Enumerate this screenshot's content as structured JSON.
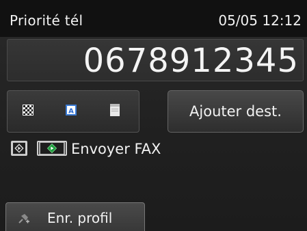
{
  "header": {
    "title": "Priorité tél",
    "datetime": "05/05 12:12"
  },
  "dial": {
    "number": "0678912345"
  },
  "mode_icons": [
    "checker-icon",
    "text-doc-icon",
    "photo-doc-icon"
  ],
  "add_button": {
    "label": "Ajouter dest."
  },
  "send": {
    "label": "Envoyer FAX",
    "icons": [
      "black-start-icon",
      "color-start-icon"
    ]
  },
  "profile_button": {
    "label": "Enr. profil",
    "icon": "pin-add-icon"
  },
  "colors": {
    "background": "#202020",
    "color_start_green": "#1e9e3e",
    "text": "#f2f2f2"
  }
}
